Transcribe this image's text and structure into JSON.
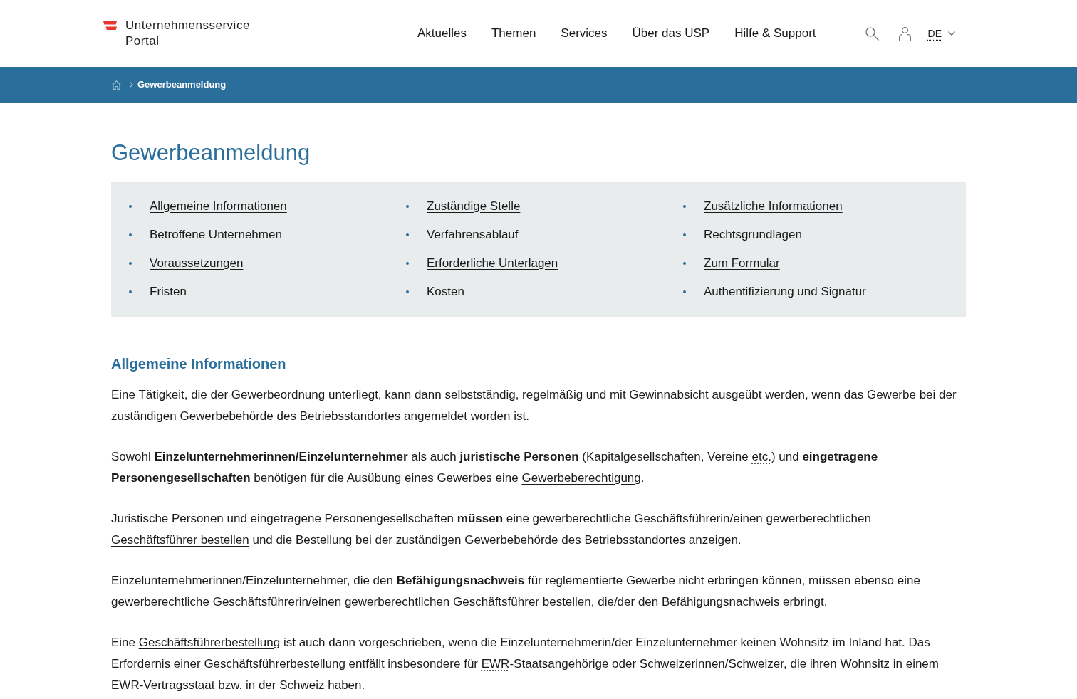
{
  "header": {
    "logo": {
      "lines": [
        "Unternehmensservice",
        "Portal"
      ]
    },
    "nav": [
      {
        "label": "Aktuelles"
      },
      {
        "label": "Themen"
      },
      {
        "label": "Services"
      },
      {
        "label": "Über das USP"
      },
      {
        "label": "Hilfe & Support"
      }
    ],
    "language": "DE"
  },
  "breadcrumb": {
    "current": "Gewerbeanmeldung"
  },
  "title": "Gewerbeanmeldung",
  "toc": {
    "columns": [
      {
        "links": [
          "Allgemeine Informationen",
          "Betroffene Unternehmen",
          "Voraussetzungen",
          "Fristen"
        ]
      },
      {
        "links": [
          "Zuständige Stelle",
          "Verfahrensablauf",
          "Erforderliche Unterlagen",
          "Kosten"
        ]
      },
      {
        "links": [
          "Zusätzliche Informationen",
          "Rechtsgrundlagen",
          "Zum Formular",
          "Authentifizierung und Signatur"
        ]
      }
    ]
  },
  "section": {
    "heading": "Allgemeine Informationen",
    "paragraphs": [
      {
        "runs": [
          {
            "kind": "text",
            "text": "Eine Tätigkeit, die der Gewerbeordnung unterliegt, kann dann selbstständig, regelmäßig und mit Gewinnabsicht ausgeübt werden, wenn das Gewerbe bei der zuständigen Gewerbebehörde des Betriebsstandortes angemeldet worden ist."
          }
        ]
      },
      {
        "runs": [
          {
            "kind": "text",
            "text": "Sowohl **Einzelunternehmerinnen/Einzelunternehmer** als auch **juristische Personen** (Kapitalgesellschaften, Vereine "
          },
          {
            "kind": "abbr",
            "text": "etc."
          },
          {
            "kind": "text",
            "text": ") und **eingetragene Personengesellschaften** benötigen für die Ausübung eines Gewerbes eine "
          },
          {
            "kind": "link",
            "text": "Gewerbeberechtigung"
          },
          {
            "kind": "text",
            "text": "."
          }
        ]
      },
      {
        "runs": [
          {
            "kind": "text",
            "text": "Juristische Personen und eingetragene Personengesellschaften **müssen** "
          },
          {
            "kind": "link",
            "text": "eine gewerberechtliche Geschäftsführerin/einen gewerberechtlichen"
          },
          {
            "kind": "link",
            "text": "Geschäftsführer bestellen"
          },
          {
            "kind": "text",
            "text": " und die Bestellung bei der zuständigen Gewerbebehörde des Betriebsstandortes anzeigen."
          }
        ]
      },
      {
        "runs": [
          {
            "kind": "text",
            "text": "Einzelunternehmerinnen/Einzelunternehmer, die den "
          },
          {
            "kind": "link",
            "text": "Befähigungsnachweis",
            "bold": true
          },
          {
            "kind": "text",
            "text": " für "
          },
          {
            "kind": "link",
            "text": "reglementierte Gewerbe"
          },
          {
            "kind": "text",
            "text": " nicht erbringen können, müssen ebenso eine gewerberechtliche Geschäftsführerin/einen gewerberechtlichen Geschäftsführer bestellen, die/der den Befähigungsnachweis erbringt."
          }
        ]
      },
      {
        "runs": [
          {
            "kind": "text",
            "text": "Eine "
          },
          {
            "kind": "link",
            "text": "Geschäftsführerbestellung"
          },
          {
            "kind": "text",
            "text": " ist auch dann vorgeschrieben, wenn die Einzelunternehmerin/der Einzelunternehmer keinen Wohnsitz im Inland hat. Das Erfordernis einer Geschäftsführerbestellung entfällt insbesondere für "
          },
          {
            "kind": "abbr",
            "text": "EWR"
          },
          {
            "kind": "text",
            "text": "-Staatsangehörige oder Schweizerinnen/Schweizer, die ihren Wohnsitz in einem EWR-Vertragsstaat bzw. in der Schweiz haben."
          }
        ]
      }
    ]
  }
}
